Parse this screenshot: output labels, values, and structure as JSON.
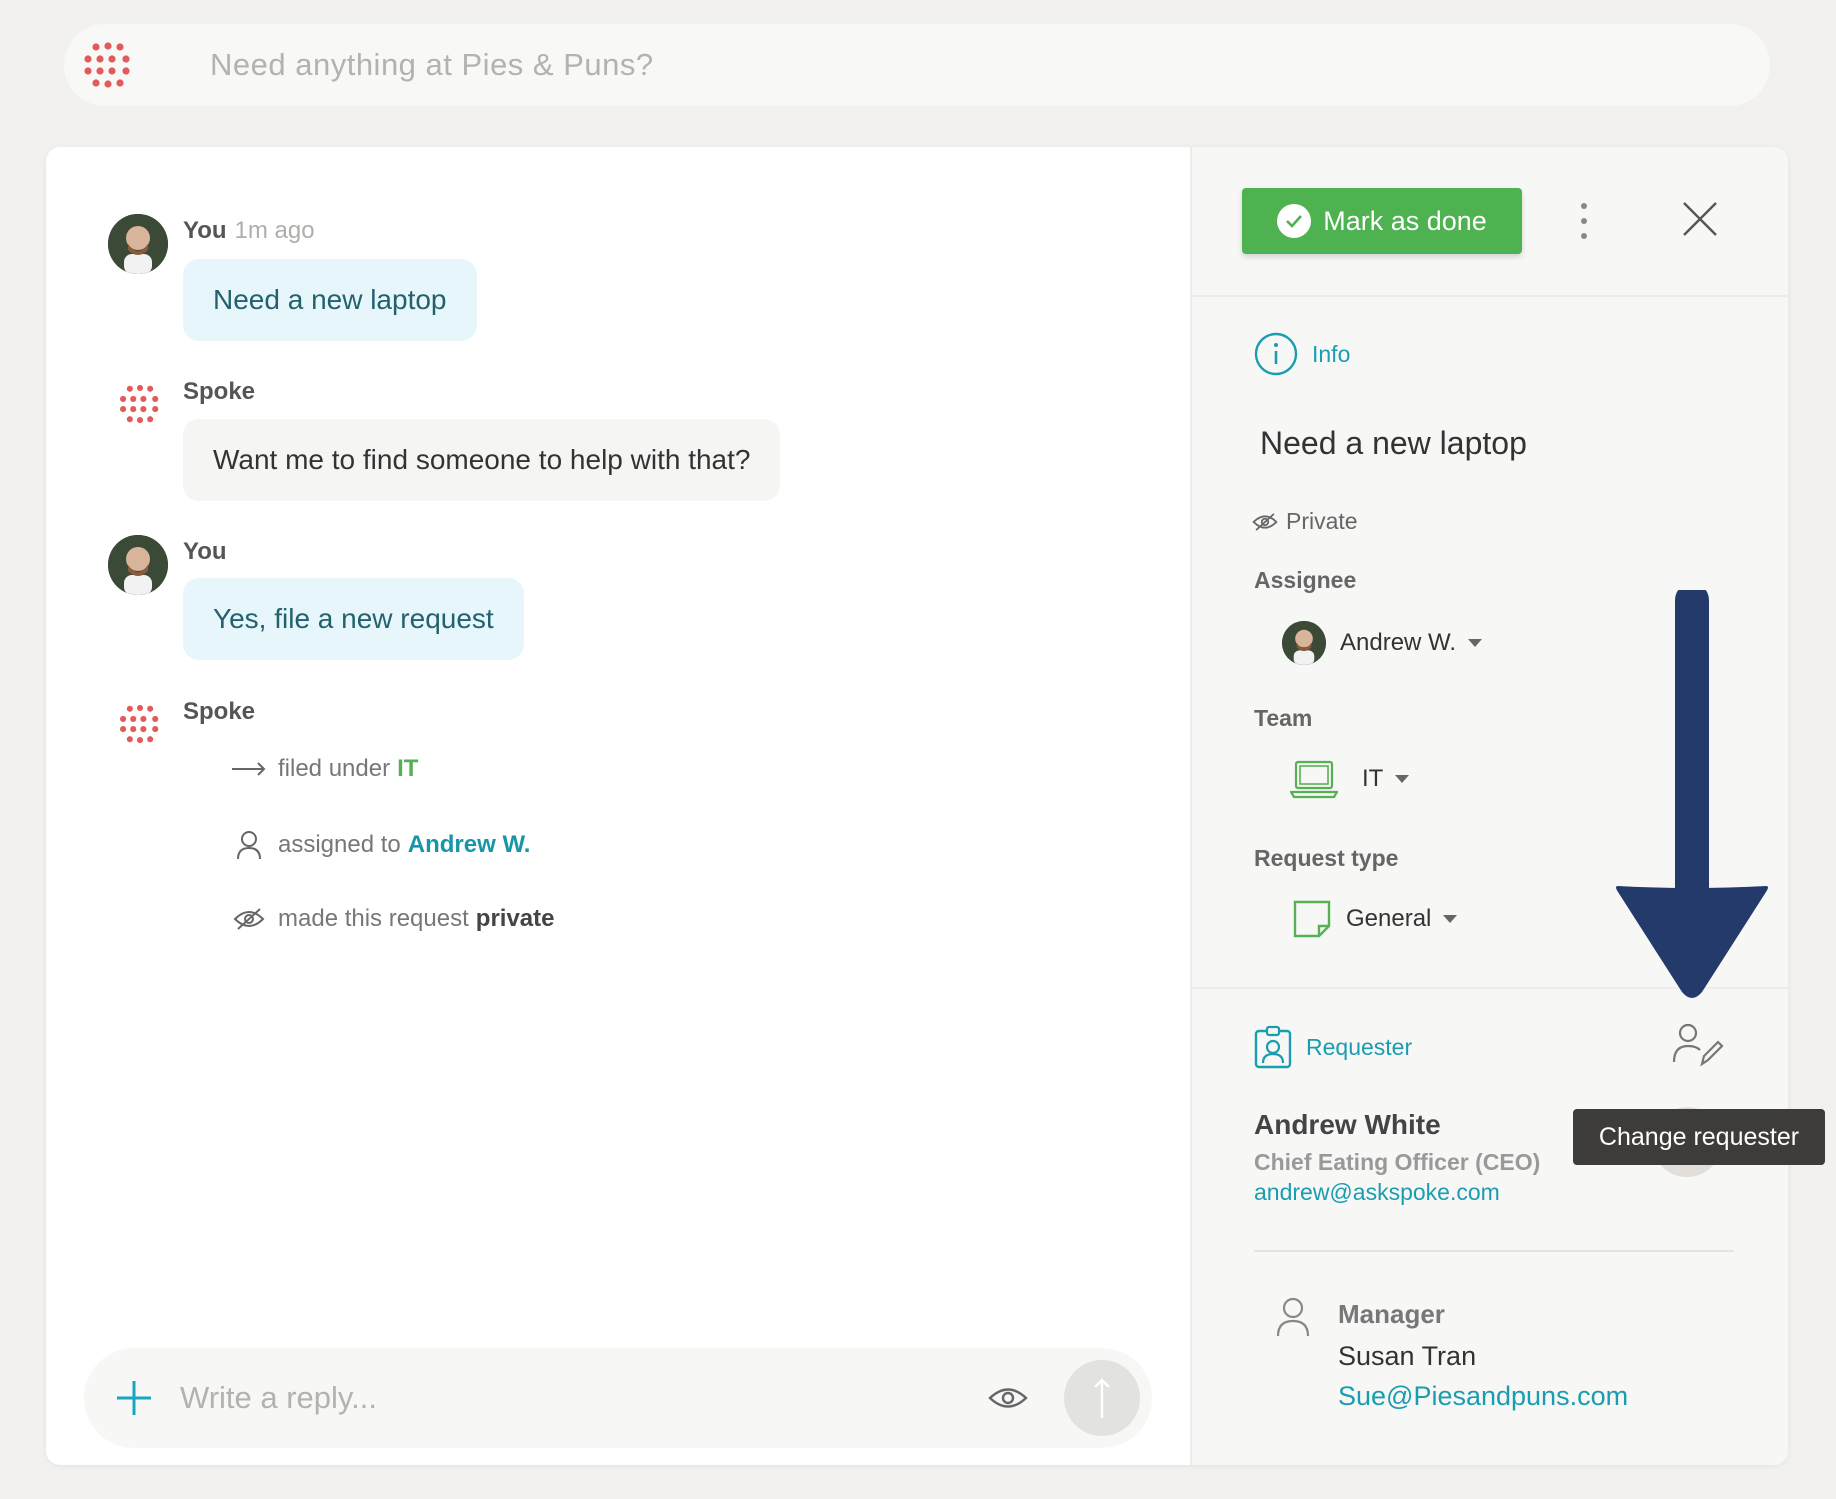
{
  "search": {
    "placeholder": "Need anything at Pies & Puns?"
  },
  "chat": {
    "messages": [
      {
        "sender": "You",
        "time": "1m ago",
        "text": "Need a new laptop"
      },
      {
        "sender": "Spoke",
        "text": "Want me to find someone to help with that?"
      },
      {
        "sender": "You",
        "text": "Yes, file a new request"
      },
      {
        "sender": "Spoke"
      }
    ],
    "events": [
      {
        "prefix": "filed under",
        "value": "IT"
      },
      {
        "prefix": "assigned to",
        "value": "Andrew W."
      },
      {
        "prefix": "made this request",
        "value": "private"
      }
    ]
  },
  "reply": {
    "placeholder": "Write a reply..."
  },
  "panel": {
    "done_label": "Mark as done",
    "info_label": "Info",
    "title": "Need a new laptop",
    "privacy": "Private",
    "assignee_label": "Assignee",
    "assignee": "Andrew W.",
    "team_label": "Team",
    "team": "IT",
    "request_type_label": "Request type",
    "request_type": "General",
    "requester_label": "Requester",
    "requester": {
      "name": "Andrew White",
      "role": "Chief Eating Officer (CEO)",
      "email": "andrew@askspoke.com"
    },
    "manager": {
      "label": "Manager",
      "name": "Susan Tran",
      "email": "Sue@Piesandpuns.com"
    },
    "tooltip": "Change requester"
  },
  "colors": {
    "brand": "#e35a5a",
    "accent": "#1a9db0",
    "success": "#4db24f",
    "annotation_arrow": "#243a6b"
  }
}
